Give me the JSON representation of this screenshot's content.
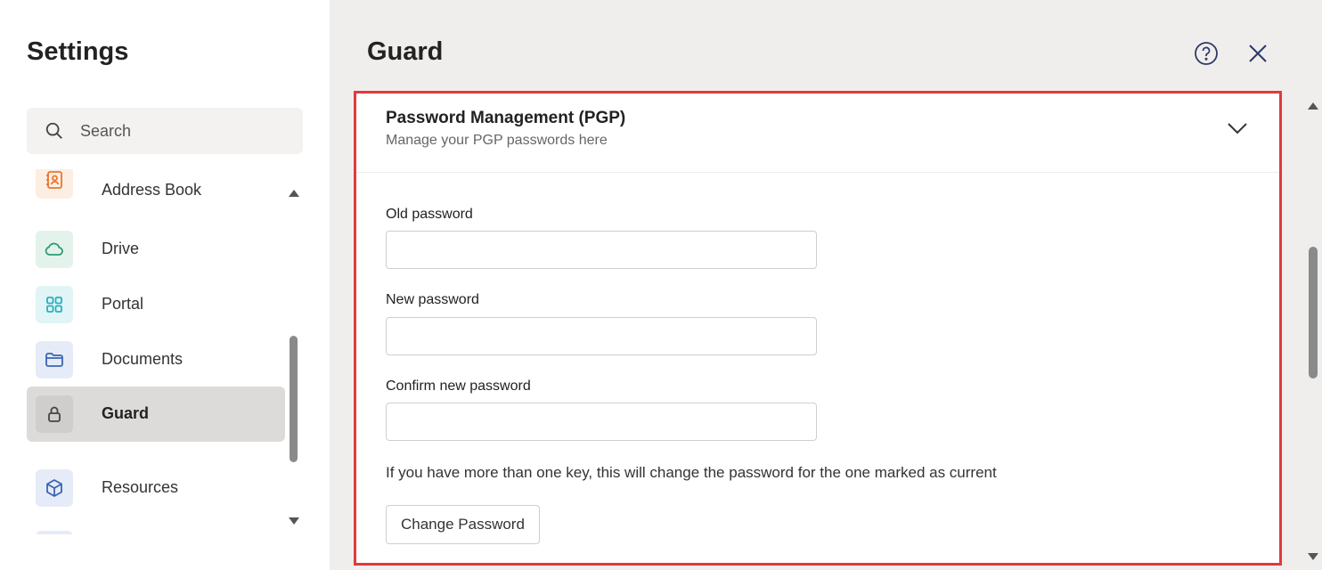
{
  "sidebar": {
    "title": "Settings",
    "search": {
      "placeholder": "Search",
      "value": ""
    },
    "items": [
      {
        "label": "Address Book",
        "icon": "address-book-icon",
        "color": "#e8772e",
        "bg": "#fdeee3"
      },
      {
        "label": "Drive",
        "icon": "cloud-icon",
        "color": "#2e9b72",
        "bg": "#e3f3ec"
      },
      {
        "label": "Portal",
        "icon": "grid-icon",
        "color": "#2aaec0",
        "bg": "#e1f4f6"
      },
      {
        "label": "Documents",
        "icon": "folder-icon",
        "color": "#3a64b5",
        "bg": "#e6ecf7"
      },
      {
        "label": "Guard",
        "icon": "lock-icon",
        "color": "#444444",
        "bg": "#cfcecd",
        "active": true
      },
      {
        "label": "Resources",
        "icon": "cube-icon",
        "color": "#3a64b5",
        "bg": "#e6ecf7"
      }
    ]
  },
  "main": {
    "title": "Guard",
    "panel": {
      "title": "Password Management (PGP)",
      "subtitle": "Manage your PGP passwords here",
      "fields": [
        {
          "label": "Old password",
          "value": ""
        },
        {
          "label": "New password",
          "value": ""
        },
        {
          "label": "Confirm new password",
          "value": ""
        }
      ],
      "info": "If you have more than one key, this will change the password for the one marked as current",
      "button_label": "Change Password"
    }
  },
  "colors": {
    "highlight_border": "#e0393e",
    "active_item_bg": "#dcdbda"
  }
}
